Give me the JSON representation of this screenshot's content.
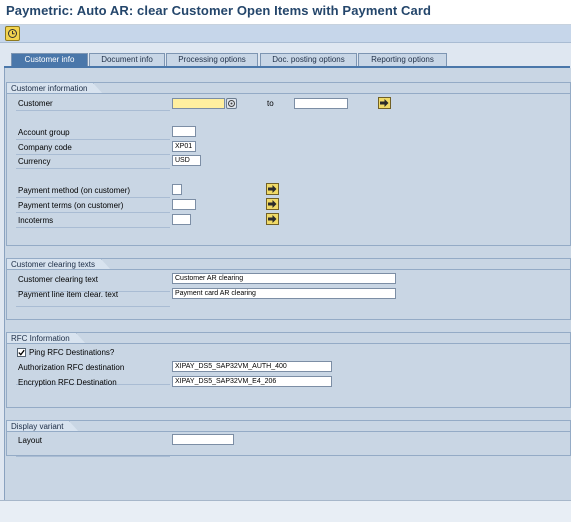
{
  "title": "Paymetric: Auto AR: clear Customer Open Items with Payment Card",
  "tabs": [
    {
      "label": "Customer info"
    },
    {
      "label": "Document info"
    },
    {
      "label": "Processing options"
    },
    {
      "label": "Doc. posting options"
    },
    {
      "label": "Reporting options"
    }
  ],
  "customer_information": {
    "header": "Customer information",
    "customer_label": "Customer",
    "customer_from": "",
    "to_label": "to",
    "customer_to": "",
    "account_group_label": "Account group",
    "account_group": "",
    "company_code_label": "Company code",
    "company_code": "XP01",
    "currency_label": "Currency",
    "currency": "USD",
    "payment_method_label": "Payment method (on customer)",
    "payment_method": "",
    "payment_terms_label": "Payment terms (on customer)",
    "payment_terms": "",
    "incoterms_label": "Incoterms",
    "incoterms": ""
  },
  "customer_clearing_texts": {
    "header": "Customer clearing texts",
    "clearing_text_label": "Customer clearing text",
    "clearing_text": "Customer AR clearing",
    "line_item_label": "Payment line item clear. text",
    "line_item_text": "Payment card AR clearing"
  },
  "rfc_information": {
    "header": "RFC Information",
    "ping_label": "Ping RFC Destinations?",
    "ping_checked": true,
    "auth_label": "Authorization RFC destination",
    "auth_value": "XIPAY_DS5_SAP32VM_AUTH_400",
    "enc_label": "Encryption RFC Destination",
    "enc_value": "XIPAY_DS5_SAP32VM_E4_206"
  },
  "display_variant": {
    "header": "Display variant",
    "layout_label": "Layout",
    "layout_value": ""
  },
  "colors": {
    "accent": "#4a77aa",
    "panel": "#c9d6e4",
    "required_field": "#ffef9f"
  }
}
